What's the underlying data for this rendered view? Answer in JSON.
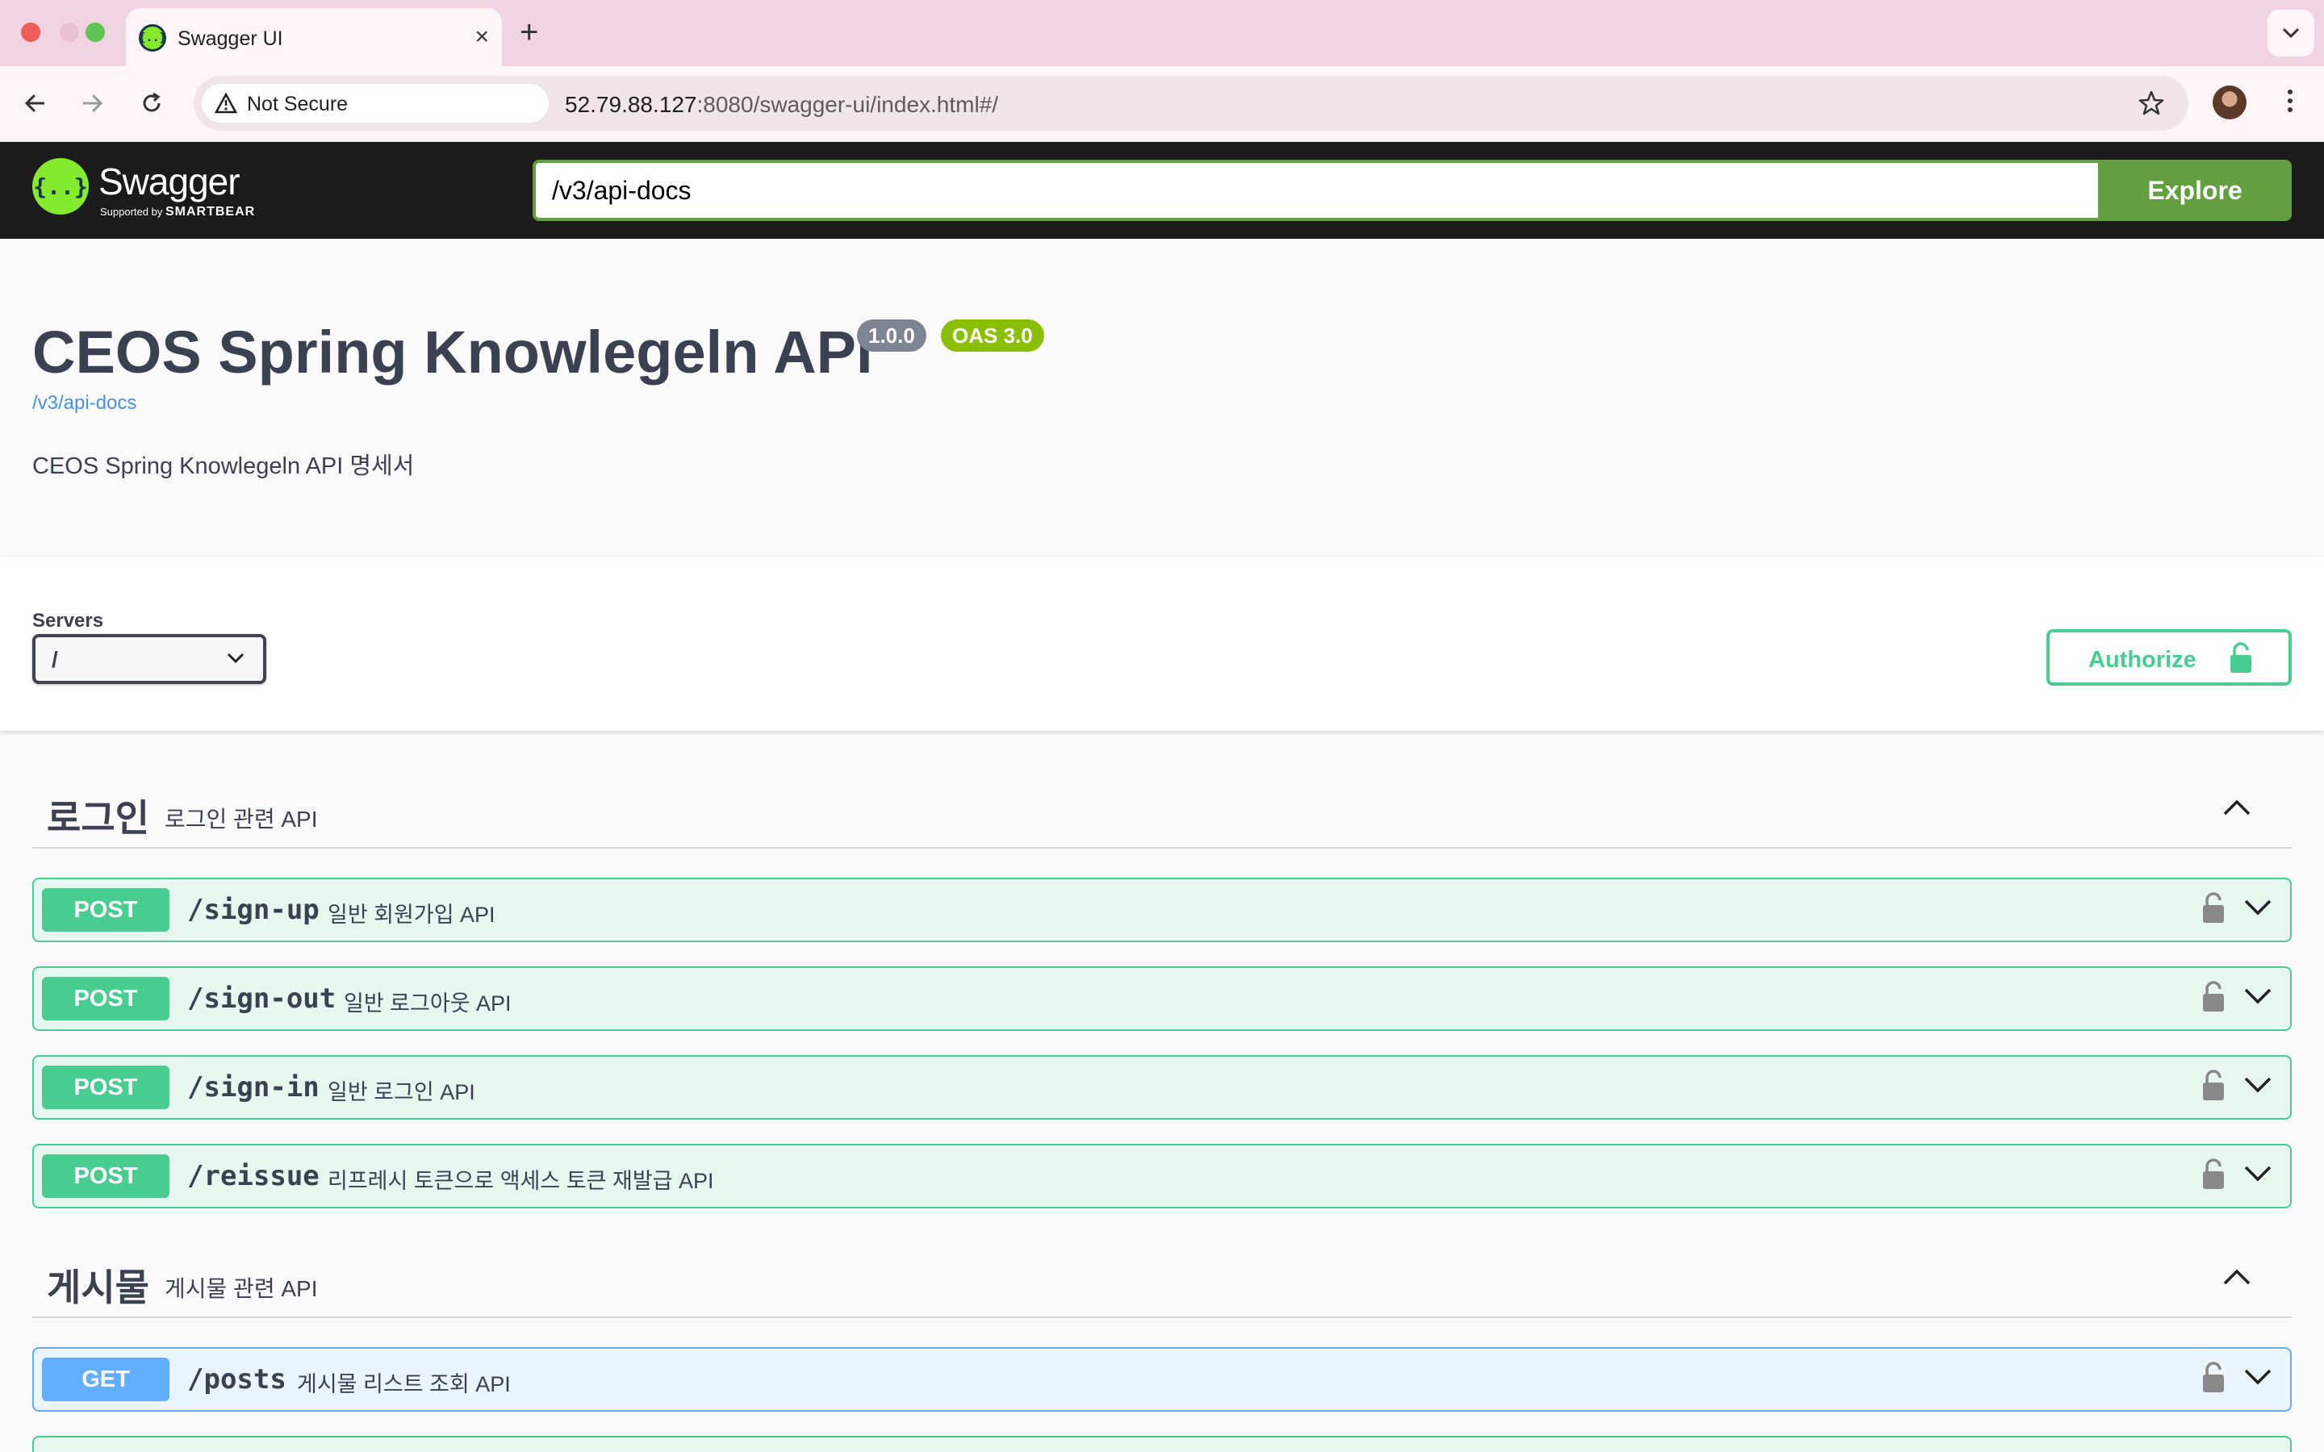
{
  "browser": {
    "tab_title": "Swagger UI",
    "tab_favicon": "swagger-favicon",
    "security_chip": "Not Secure",
    "url_host": "52.79.88.127",
    "url_rest": ":8080/swagger-ui/index.html#/"
  },
  "topbar": {
    "logo_word": "Swagger",
    "logo_supported": "Supported by",
    "logo_brand": "SMARTBEAR",
    "spec_url_value": "/v3/api-docs",
    "explore_label": "Explore"
  },
  "info": {
    "title": "CEOS Spring Knowlegeln API",
    "version": "1.0.0",
    "oas": "OAS 3.0",
    "spec_link": "/v3/api-docs",
    "description": "CEOS Spring Knowlegeln API 명세서"
  },
  "schemes": {
    "servers_label": "Servers",
    "servers_selected": "/",
    "authorize_label": "Authorize"
  },
  "tags": [
    {
      "name": "로그인",
      "description": "로그인 관련 API",
      "operations": [
        {
          "method": "POST",
          "path": "/sign-up",
          "summary": "일반 회원가입 API"
        },
        {
          "method": "POST",
          "path": "/sign-out",
          "summary": "일반 로그아웃 API"
        },
        {
          "method": "POST",
          "path": "/sign-in",
          "summary": "일반 로그인 API"
        },
        {
          "method": "POST",
          "path": "/reissue",
          "summary": "리프레시 토큰으로 액세스 토큰 재발급 API"
        }
      ]
    },
    {
      "name": "게시물",
      "description": "게시물 관련 API",
      "operations": [
        {
          "method": "GET",
          "path": "/posts",
          "summary": "게시물 리스트 조회 API"
        }
      ]
    }
  ],
  "colors": {
    "post": "#49cc90",
    "get": "#61affe",
    "swagger_green": "#85ea2d",
    "explore": "#62a03f"
  }
}
